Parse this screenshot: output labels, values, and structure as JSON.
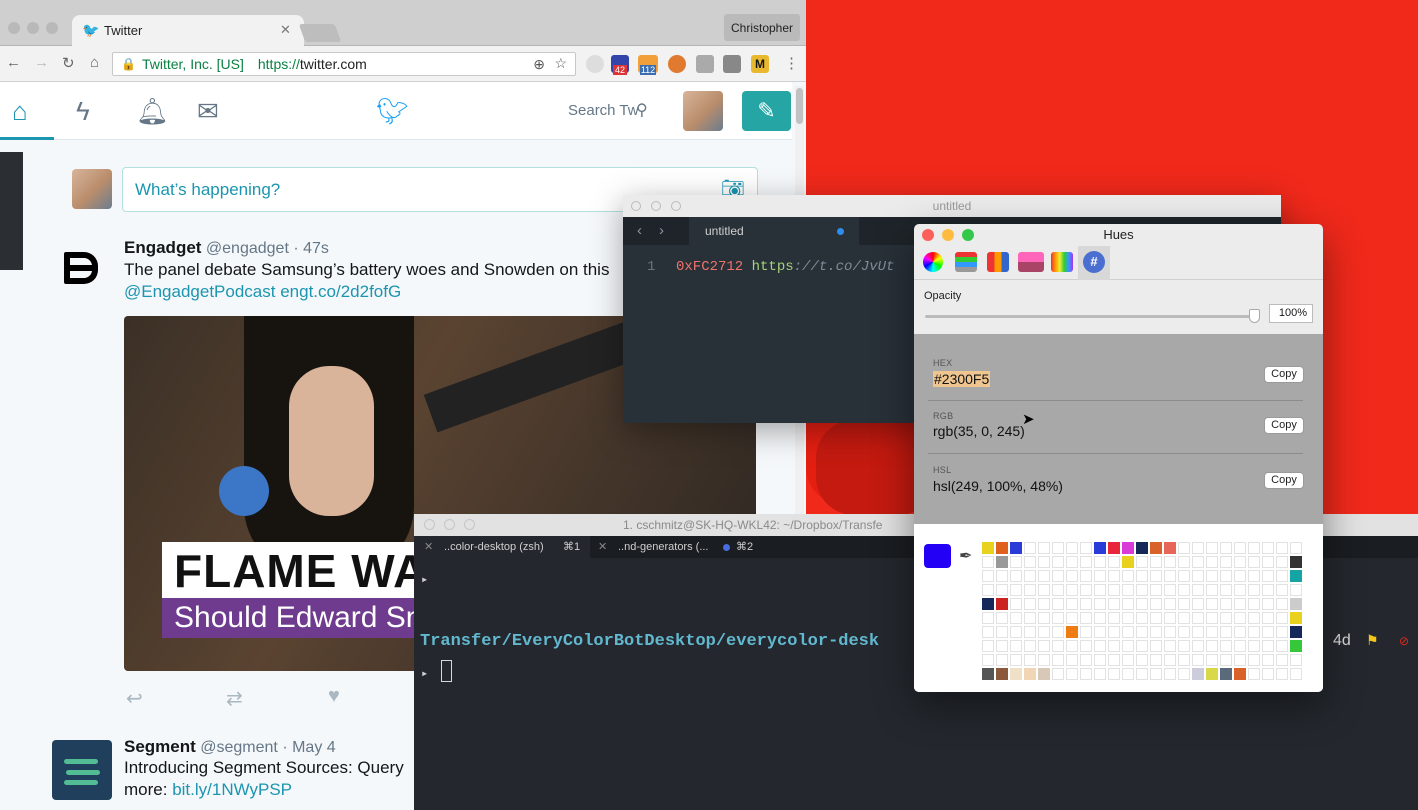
{
  "browser": {
    "tab_title": "Twitter",
    "profile_name": "Christopher",
    "site_identity": "Twitter, Inc. [US]",
    "url_scheme": "https://",
    "url_host": "twitter.com",
    "ext_badge_1": "42",
    "ext_badge_2": "112",
    "ext_m_label": "M"
  },
  "twitter": {
    "search_placeholder": "Search Tw",
    "composer_placeholder": "What’s happening?",
    "tweets": [
      {
        "name": "Engadget",
        "handle": "@engadget",
        "time": "· 47s",
        "text": "The panel debate Samsung’s battery woes and Snowden on this",
        "link1": "@EngadgetPodcast",
        "link2": "engt.co/2d2fofG",
        "media_headline": "FLAME WA",
        "media_subline": "Should Edward Sn"
      },
      {
        "name": "Segment",
        "handle": "@segment",
        "time": "· May 4",
        "text": "Introducing Segment Sources: Query",
        "more": "more:",
        "link": "bit.ly/1NWyPSP"
      }
    ]
  },
  "sublime": {
    "title": "untitled",
    "tab_label": "untitled",
    "line_number": "1",
    "code_hex": "0xFC2712",
    "code_url_a": "https",
    "code_url_b": "://t.co/JvUt"
  },
  "hues": {
    "title": "Hues",
    "opacity_label": "Opacity",
    "opacity_value": "100%",
    "opacity_fraction": 1.0,
    "hex_label": "HEX",
    "hex_value": "#2300F5",
    "rgb_label": "RGB",
    "rgb_value": "rgb(35, 0, 245)",
    "hsl_label": "HSL",
    "hsl_value": "hsl(249, 100%, 48%)",
    "copy_label": "Copy",
    "current_color": "#2300f5"
  },
  "iterm": {
    "title": "1. cschmitz@SK-HQ-WKL42: ~/Dropbox/Transfe",
    "tab1_label": "..color-desktop (zsh)",
    "tab1_shortcut": "⌘1",
    "tab2_label": "..nd-generators (...",
    "tab2_shortcut": "⌘2",
    "prompt_path": "Transfer/EveryColorBotDesktop/everycolor-desk",
    "prompt_right": "4d",
    "prompt_glyph": "▸"
  },
  "colors": {
    "desktop_red": "#f0291b",
    "twitter_teal": "#1b95b0",
    "selected_color": "#2300f5"
  }
}
